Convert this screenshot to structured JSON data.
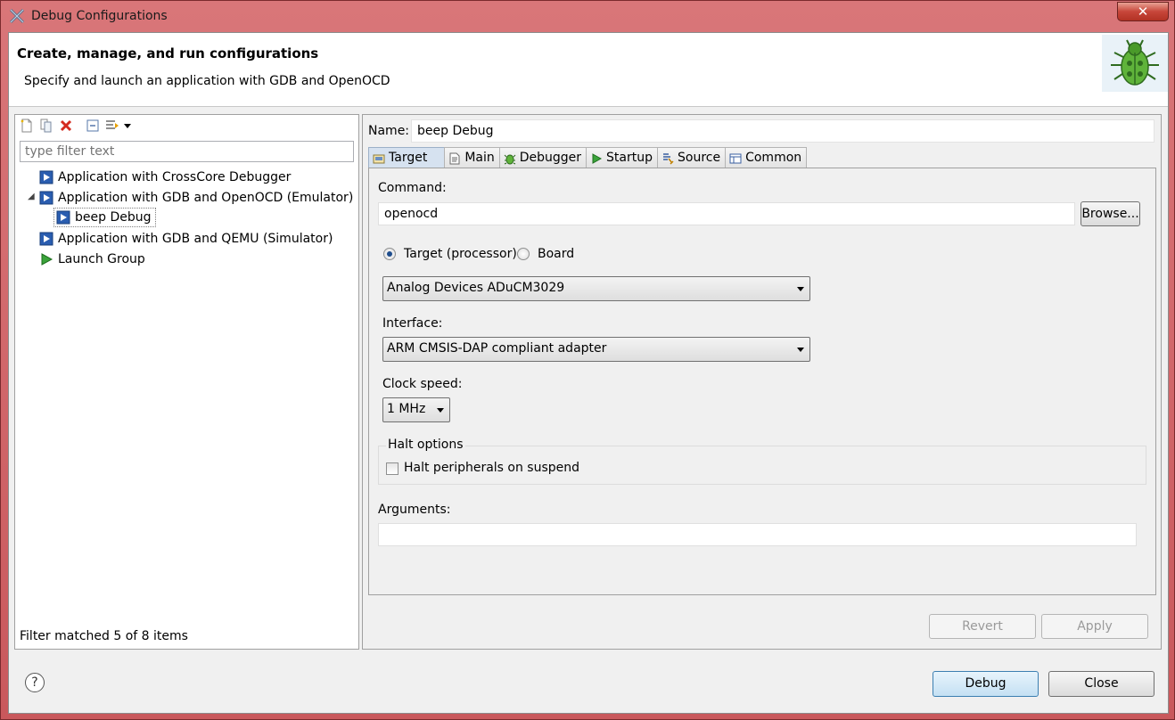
{
  "window": {
    "title": "Debug Configurations",
    "close_label": "✕"
  },
  "header": {
    "title": "Create, manage, and run configurations",
    "subtitle": "Specify and launch an application with GDB and OpenOCD"
  },
  "left_panel": {
    "toolbar": [
      "new-config-icon",
      "duplicate-icon",
      "delete-icon",
      "collapse-all-icon",
      "filter-icon",
      "dropdown-icon"
    ],
    "filter_placeholder": "type filter text",
    "tree": [
      {
        "label": "Application with CrossCore Debugger",
        "icon": "app-launch-icon",
        "level": 0,
        "expanded": false
      },
      {
        "label": "Application with GDB and OpenOCD (Emulator)",
        "icon": "app-launch-icon",
        "level": 0,
        "expanded": true
      },
      {
        "label": "beep Debug",
        "icon": "app-launch-icon",
        "level": 1,
        "selected": true
      },
      {
        "label": "Application with GDB and QEMU (Simulator)",
        "icon": "app-launch-icon",
        "level": 0,
        "expanded": false
      },
      {
        "label": "Launch Group",
        "icon": "launch-group-icon",
        "level": 0,
        "expanded": false
      }
    ],
    "status": "Filter matched 5 of 8 items"
  },
  "right_panel": {
    "name_label": "Name:",
    "name_value": "beep Debug",
    "tabs": [
      {
        "label": "Target",
        "icon": "target-icon",
        "active": true
      },
      {
        "label": "Main",
        "icon": "main-icon"
      },
      {
        "label": "Debugger",
        "icon": "debugger-icon"
      },
      {
        "label": "Startup",
        "icon": "startup-icon"
      },
      {
        "label": "Source",
        "icon": "source-icon"
      },
      {
        "label": "Common",
        "icon": "common-icon"
      }
    ],
    "target_tab": {
      "command_label": "Command:",
      "command_value": "openocd",
      "browse_label": "Browse...",
      "radio_target_label": "Target (processor)",
      "radio_board_label": "Board",
      "target_selected": "Analog Devices ADuCM3029",
      "interface_label": "Interface:",
      "interface_selected": "ARM CMSIS-DAP compliant adapter",
      "clock_label": "Clock speed:",
      "clock_selected": "1 MHz",
      "halt_group_title": "Halt options",
      "halt_checkbox_label": "Halt peripherals on suspend",
      "halt_checked": false,
      "arguments_label": "Arguments:",
      "arguments_value": ""
    },
    "revert_label": "Revert",
    "apply_label": "Apply"
  },
  "footer": {
    "help_label": "?",
    "debug_label": "Debug",
    "close_label": "Close"
  }
}
